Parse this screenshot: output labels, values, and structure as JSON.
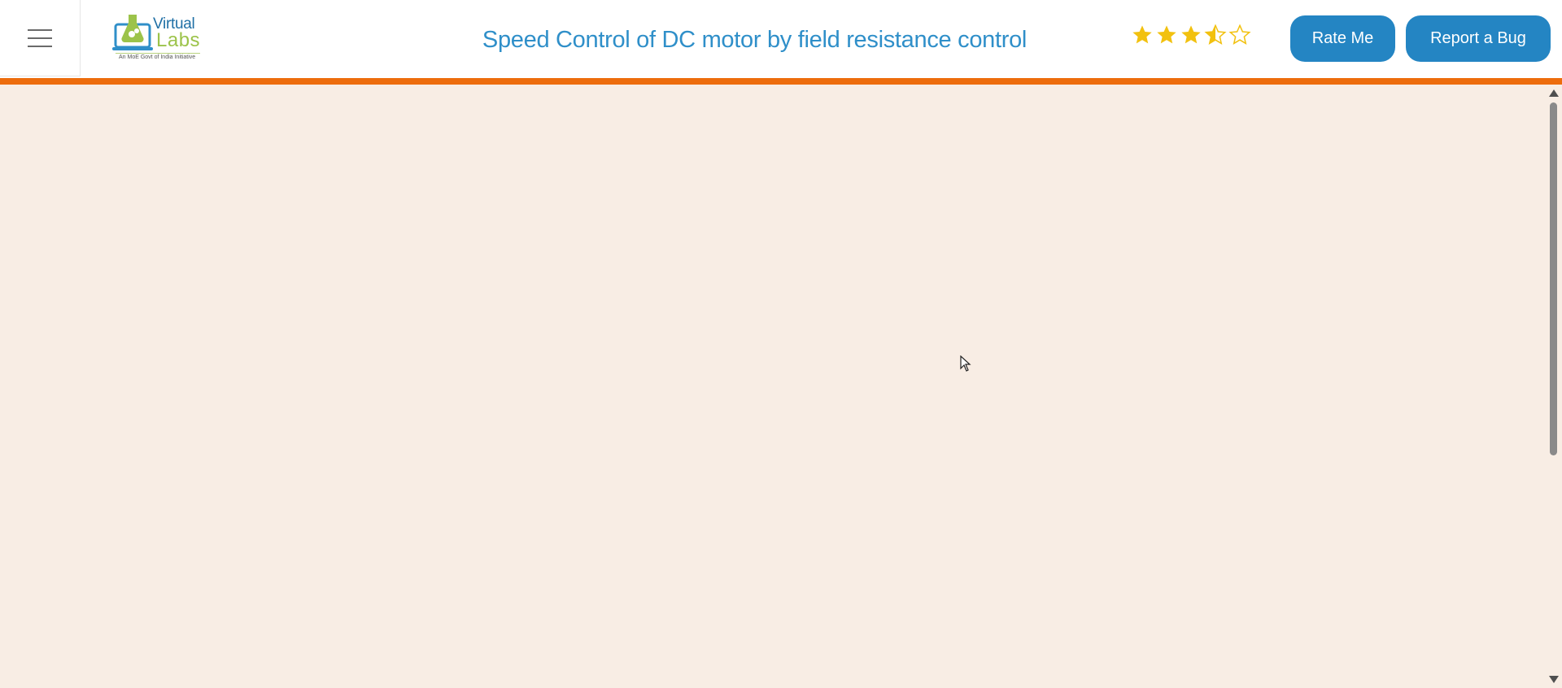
{
  "header": {
    "menu_icon": "hamburger-icon",
    "logo": {
      "word1": "Virtual",
      "word2": "Labs",
      "tagline": "An MoE Govt of India Initiative"
    },
    "title": "Speed Control of DC motor by field resistance control",
    "rating": {
      "value": 3.5,
      "max": 5,
      "star_color": "#f2c10f"
    },
    "buttons": {
      "rate_label": "Rate Me",
      "bug_label": "Report a Bug"
    }
  },
  "colors": {
    "accent": "#ed6c0c",
    "button": "#2485c3",
    "title": "#2f8fc9",
    "background": "#f8ede4"
  }
}
